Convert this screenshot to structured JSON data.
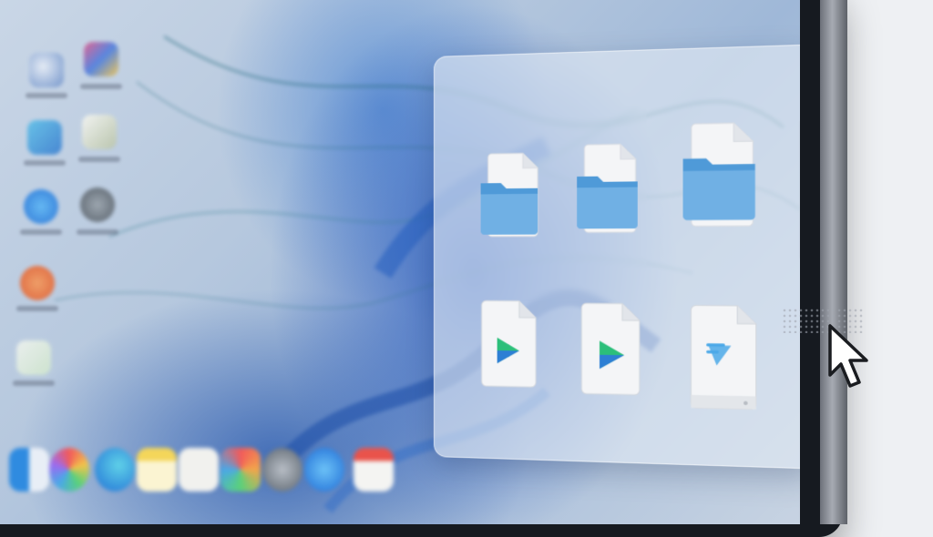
{
  "colors": {
    "folder_blue": "#4f9ad8",
    "folder_blue_light": "#7fb9ea",
    "paper_white": "#f4f5f7",
    "play_green": "#2bbf7a",
    "play_blue": "#2d7fd4",
    "accent_blue": "#4aa8e8"
  },
  "desktop": {
    "icons": [
      "blurred-app-icon",
      "blurred-app-icon",
      "blurred-app-icon",
      "blurred-app-icon",
      "blurred-app-icon",
      "blurred-app-icon",
      "blurred-app-icon",
      "blurred-app-icon",
      "blurred-app-icon"
    ]
  },
  "dock": {
    "apps": [
      "finder-icon",
      "color-wheel-icon",
      "edge-icon",
      "notes-icon",
      "document-icon",
      "photos-icon",
      "settings-icon",
      "app-store-icon",
      "calendar-icon"
    ]
  },
  "folder_window": {
    "items": [
      {
        "kind": "folder",
        "icon": "folder-with-document-icon"
      },
      {
        "kind": "folder",
        "icon": "folder-with-document-icon"
      },
      {
        "kind": "folder",
        "icon": "folder-with-document-icon"
      },
      {
        "kind": "video",
        "icon": "video-file-icon"
      },
      {
        "kind": "video",
        "icon": "video-file-icon"
      },
      {
        "kind": "presentation",
        "icon": "presentation-file-icon"
      }
    ]
  },
  "cursor": {
    "icon": "mouse-pointer-icon"
  }
}
